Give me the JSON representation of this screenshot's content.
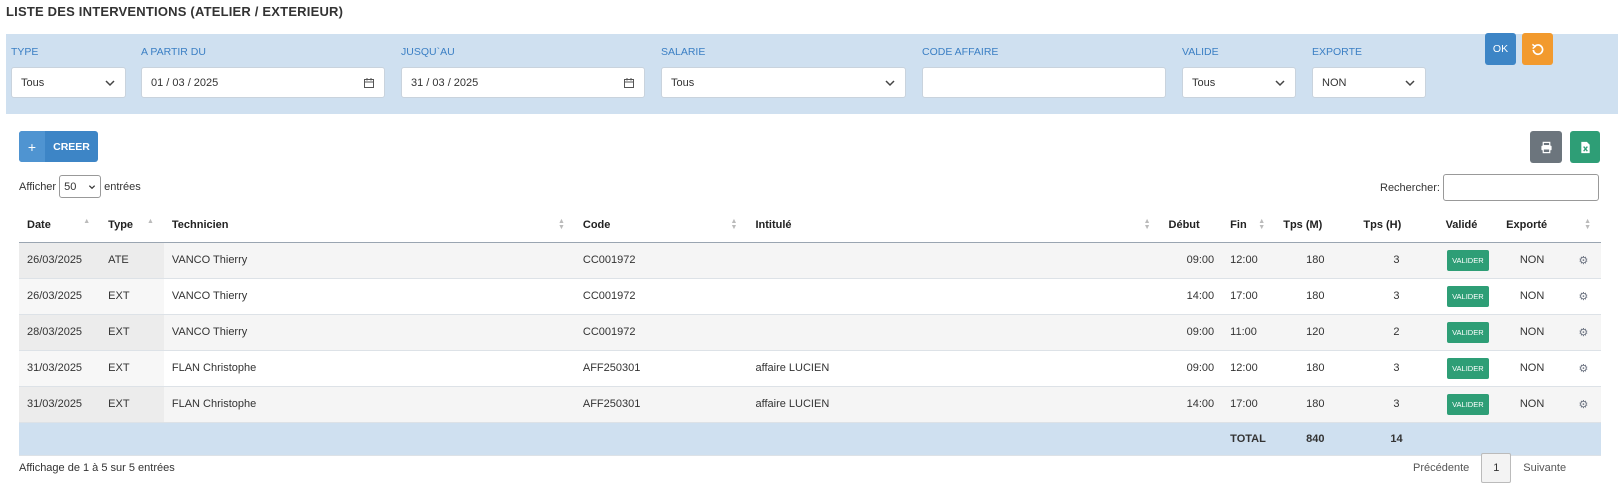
{
  "page": {
    "title": "LISTE DES INTERVENTIONS (ATELIER / EXTERIEUR)"
  },
  "filters": {
    "type": {
      "label": "TYPE",
      "value": "Tous"
    },
    "date_from": {
      "label": "A PARTIR DU",
      "value": "01 / 03 / 2025"
    },
    "date_to": {
      "label": "JUSQU`AU",
      "value": "31 / 03 / 2025"
    },
    "salarie": {
      "label": "SALARIE",
      "value": "Tous"
    },
    "code_affaire": {
      "label": "CODE AFFAIRE",
      "value": ""
    },
    "valide": {
      "label": "VALIDE",
      "value": "Tous"
    },
    "exporte": {
      "label": "EXPORTE",
      "value": "NON"
    },
    "ok_label": "OK"
  },
  "toolbar": {
    "create_label": "CREER",
    "create_icon": "plus-icon",
    "print_icon": "print-icon",
    "excel_icon": "excel-icon"
  },
  "length_menu": {
    "prefix": "Afficher",
    "value": "50",
    "suffix": "entrées"
  },
  "search": {
    "label": "Rechercher:"
  },
  "table": {
    "headers": {
      "date": "Date",
      "type": "Type",
      "technicien": "Technicien",
      "code": "Code",
      "intitule": "Intitulé",
      "debut": "Début",
      "fin": "Fin",
      "tps_m": "Tps (M)",
      "tps_h": "Tps (H)",
      "valide": "Validé",
      "exporte": "Exporté"
    },
    "rows": [
      {
        "date": "26/03/2025",
        "type": "ATE",
        "technicien": "VANCO Thierry",
        "code": "CC001972",
        "intitule": "",
        "debut": "09:00",
        "fin": "12:00",
        "tps_m": "180",
        "tps_h": "3",
        "valide": "VALIDER",
        "exporte": "NON"
      },
      {
        "date": "26/03/2025",
        "type": "EXT",
        "technicien": "VANCO Thierry",
        "code": "CC001972",
        "intitule": "",
        "debut": "14:00",
        "fin": "17:00",
        "tps_m": "180",
        "tps_h": "3",
        "valide": "VALIDER",
        "exporte": "NON"
      },
      {
        "date": "28/03/2025",
        "type": "EXT",
        "technicien": "VANCO Thierry",
        "code": "CC001972",
        "intitule": "",
        "debut": "09:00",
        "fin": "11:00",
        "tps_m": "120",
        "tps_h": "2",
        "valide": "VALIDER",
        "exporte": "NON"
      },
      {
        "date": "31/03/2025",
        "type": "EXT",
        "technicien": "FLAN Christophe",
        "code": "AFF250301",
        "intitule": "affaire LUCIEN",
        "debut": "09:00",
        "fin": "12:00",
        "tps_m": "180",
        "tps_h": "3",
        "valide": "VALIDER",
        "exporte": "NON"
      },
      {
        "date": "31/03/2025",
        "type": "EXT",
        "technicien": "FLAN Christophe",
        "code": "AFF250301",
        "intitule": "affaire LUCIEN",
        "debut": "14:00",
        "fin": "17:00",
        "tps_m": "180",
        "tps_h": "3",
        "valide": "VALIDER",
        "exporte": "NON"
      }
    ],
    "footer": {
      "total_label": "TOTAL",
      "tps_m": "840",
      "tps_h": "14"
    }
  },
  "pagination": {
    "info": "Affichage de 1 à 5 sur 5 entrées",
    "prev": "Précédente",
    "page": "1",
    "next": "Suivante"
  }
}
